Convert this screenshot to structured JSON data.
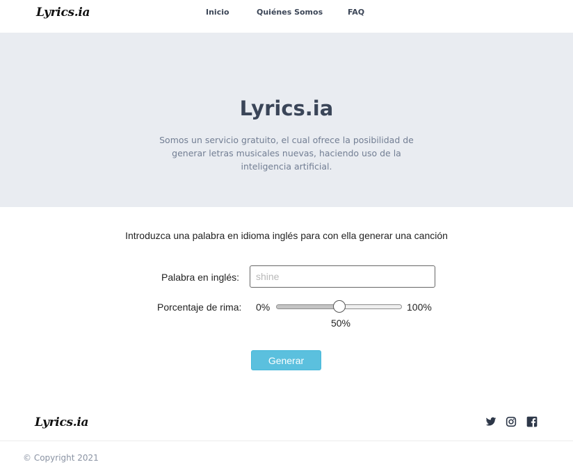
{
  "brand": {
    "logo_text": "Lyrics.ia"
  },
  "nav": {
    "links": [
      {
        "label": "Inicio"
      },
      {
        "label": "Quiénes Somos"
      },
      {
        "label": "FAQ"
      }
    ]
  },
  "hero": {
    "title": "Lyrics.ia",
    "description": "Somos un servicio gratuito, el cual ofrece la posibilidad de generar letras musicales nuevas, haciendo uso de la inteligencia artificial."
  },
  "form": {
    "instruction": "Introduzca una palabra en idioma inglés para con ella generar una canción",
    "word_label": "Palabra en inglés:",
    "word_value": "",
    "word_placeholder": "shine",
    "rhyme_label": "Porcentaje de rima:",
    "rhyme_min_label": "0%",
    "rhyme_max_label": "100%",
    "rhyme_value": 50,
    "rhyme_value_label": "50%",
    "submit_label": "Generar"
  },
  "footer": {
    "logo_text": "Lyrics.ia",
    "social_icons": [
      "twitter-icon",
      "instagram-icon",
      "facebook-icon"
    ],
    "copyright": "© Copyright 2021"
  },
  "colors": {
    "hero_background": "#e9ecf1",
    "button": "#5bc0de",
    "heading": "#3a4558"
  }
}
